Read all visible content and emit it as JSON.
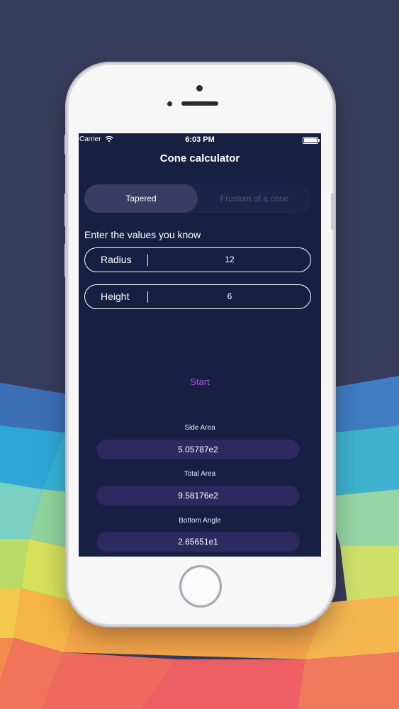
{
  "status_bar": {
    "carrier": "Carrier",
    "time": "6:03 PM"
  },
  "app": {
    "title": "Cone calculator"
  },
  "segment": {
    "tabs": [
      "Tapered",
      "Frustum of a cone"
    ],
    "selected": "Tapered"
  },
  "form": {
    "prompt": "Enter the values you know",
    "fields": [
      {
        "label": "Radius",
        "value": "12"
      },
      {
        "label": "Height",
        "value": "6"
      }
    ]
  },
  "actions": {
    "start": "Start"
  },
  "results": [
    {
      "label": "Side Area",
      "value": "5.05787e2"
    },
    {
      "label": "Total Area",
      "value": "9.58176e2"
    },
    {
      "label": "Bottom Angle",
      "value": "2.65651e1"
    }
  ],
  "colors": {
    "screen_bg": "#172042",
    "segment_active": "#3a3c63",
    "result_box": "#2e2960",
    "accent": "#a057d8",
    "backdrop": "#373c5c"
  }
}
